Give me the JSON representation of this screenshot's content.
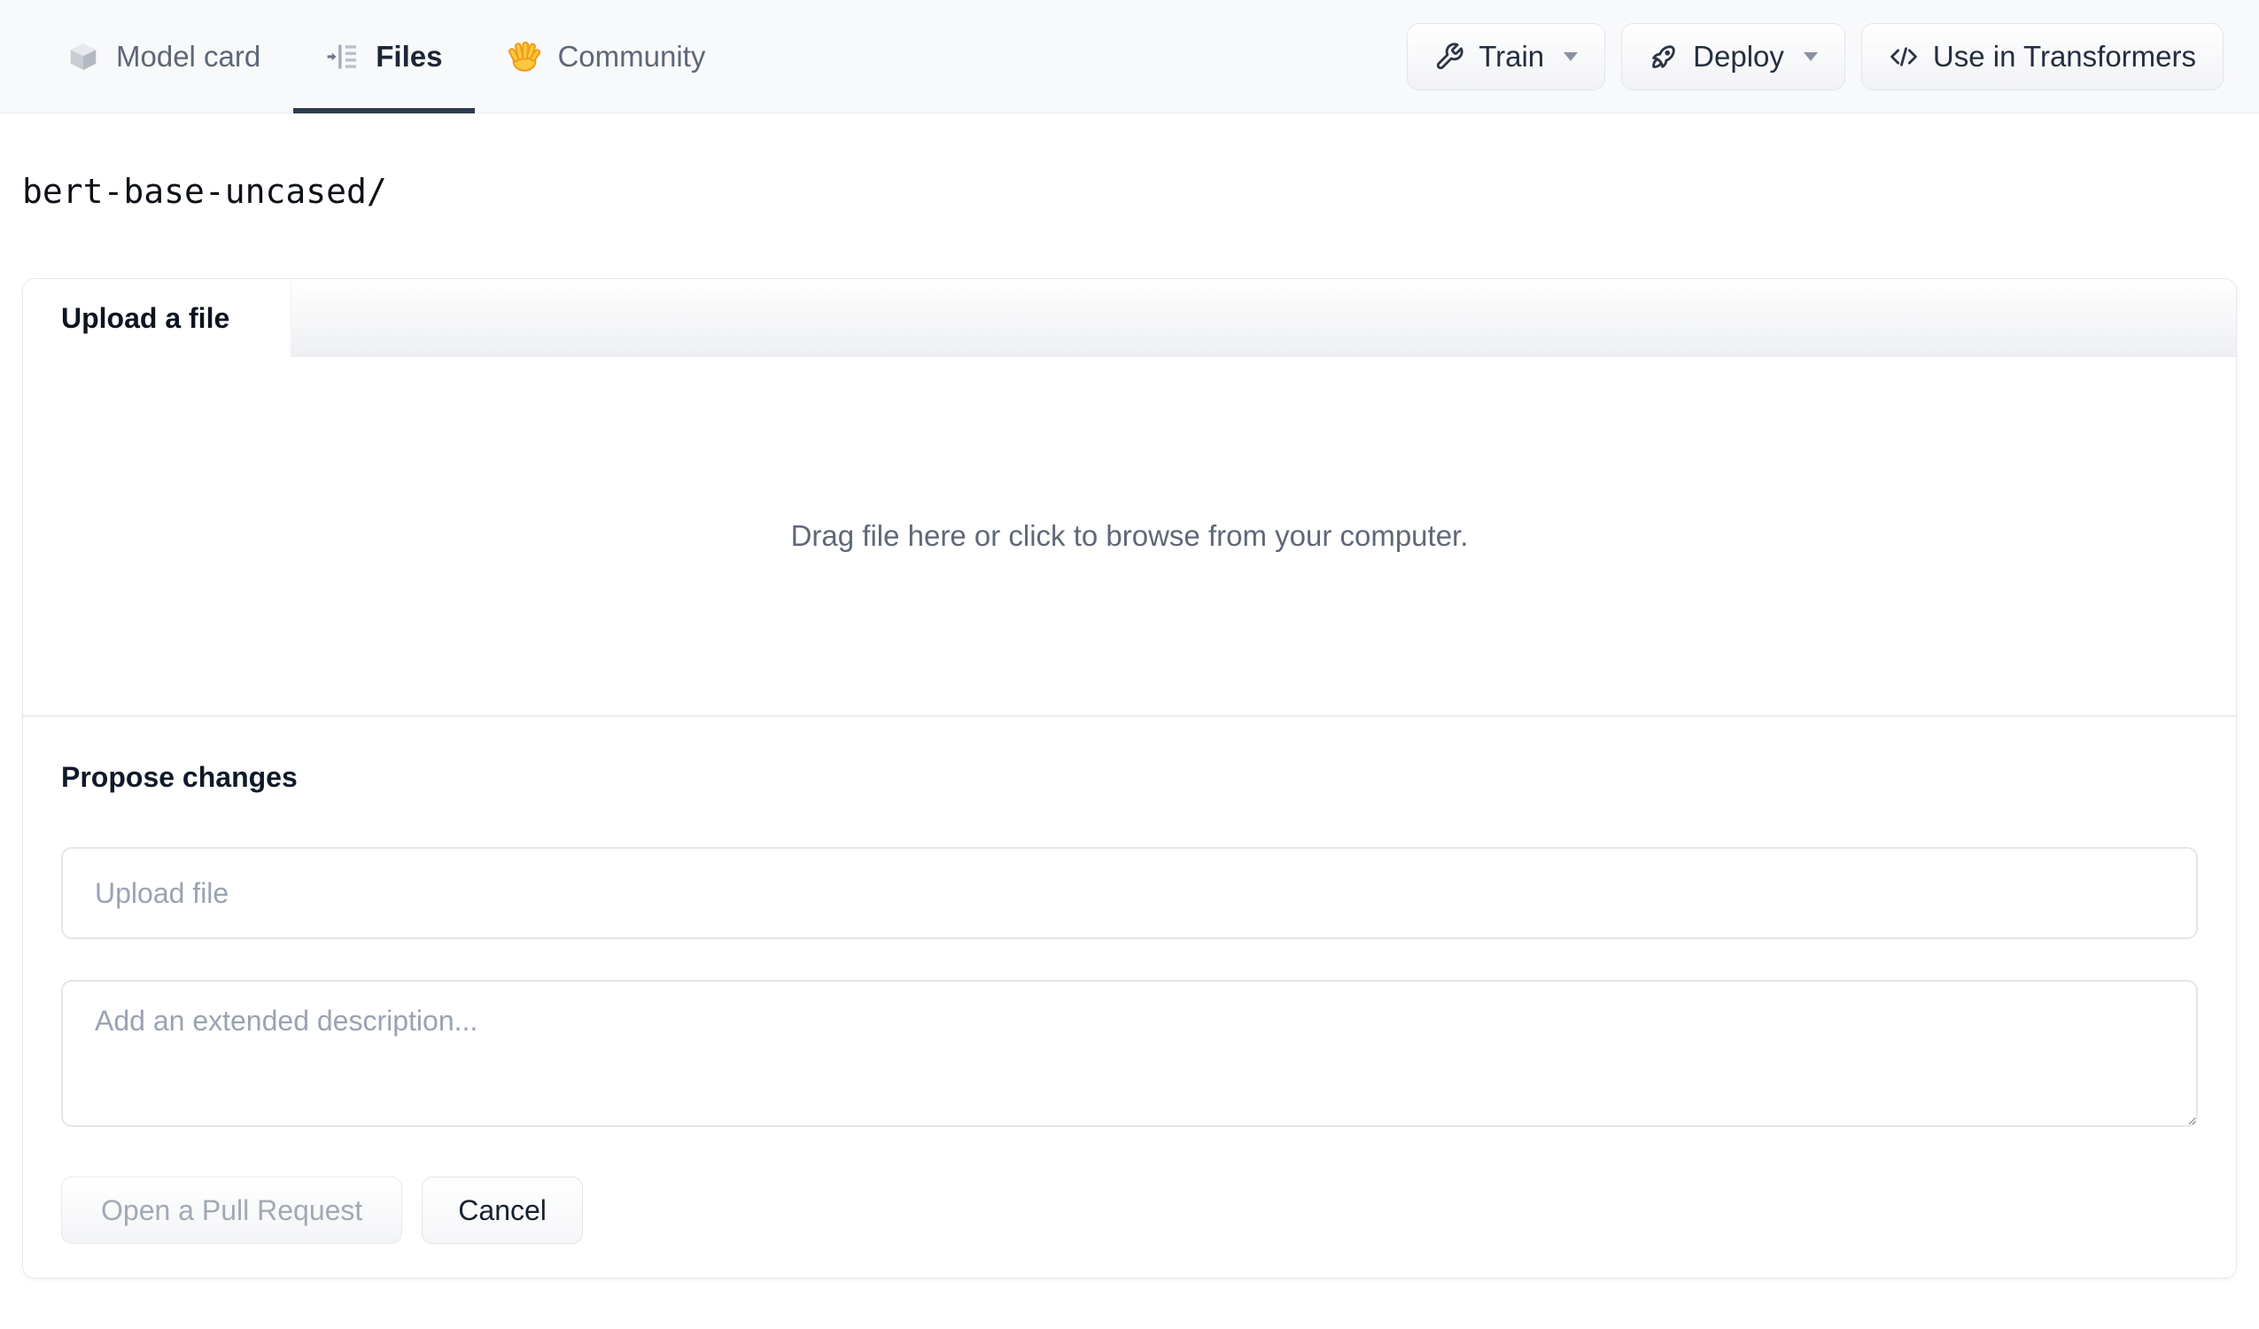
{
  "header": {
    "tabs": [
      {
        "label": "Model card",
        "icon": "cube-icon",
        "active": false
      },
      {
        "label": "Files",
        "icon": "files-list-icon",
        "active": true
      },
      {
        "label": "Community",
        "icon": "waving-hand-icon",
        "active": false
      }
    ],
    "actions": [
      {
        "label": "Train",
        "icon": "wrench-icon",
        "caret": true
      },
      {
        "label": "Deploy",
        "icon": "rocket-icon",
        "caret": true
      },
      {
        "label": "Use in Transformers",
        "icon": "code-icon",
        "caret": false
      }
    ]
  },
  "breadcrumb": {
    "path": "bert-base-uncased/"
  },
  "upload_panel": {
    "tab_label": "Upload a file",
    "dropzone_text": "Drag file here or click to browse from your computer.",
    "propose_heading": "Propose changes",
    "filename_value": "",
    "filename_placeholder": "Upload file",
    "description_value": "",
    "description_placeholder": "Add an extended description...",
    "submit_label": "Open a Pull Request",
    "cancel_label": "Cancel"
  },
  "colors": {
    "topnav_background": "#f8f9fb",
    "active_tab_underline": "#2d3a4d",
    "community_hand_yellow": "#ffc83d",
    "muted_text": "#5f6877"
  }
}
